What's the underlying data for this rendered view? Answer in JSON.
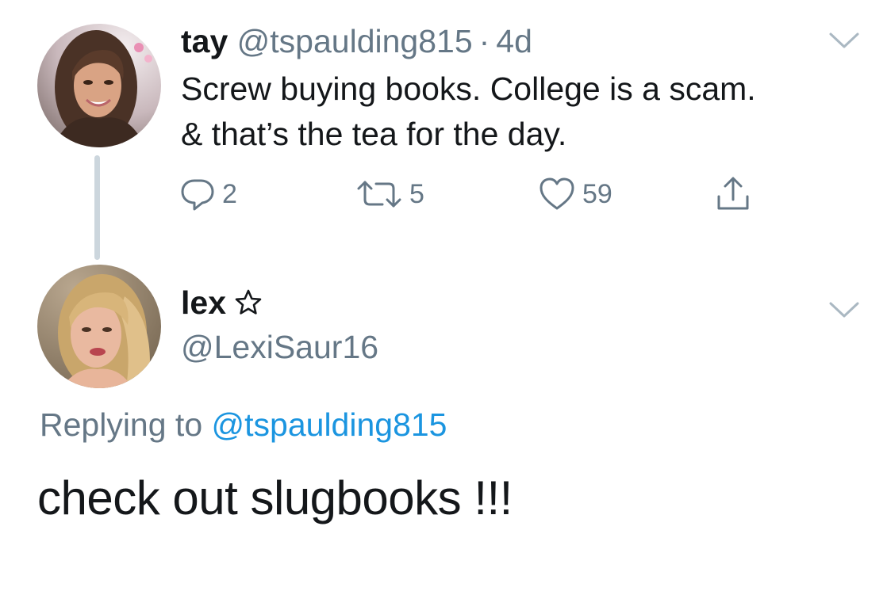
{
  "tweet": {
    "author_name": "tay",
    "author_handle": "@tspaulding815",
    "separator": "·",
    "time": "4d",
    "text_lines": [
      "Screw buying books. College is a scam.",
      "& that’s the tea for the day."
    ],
    "actions": {
      "reply_count": "2",
      "retweet_count": "5",
      "like_count": "59"
    },
    "avatar_icon": "profile-photo-tay"
  },
  "reply": {
    "author_name": "lex",
    "author_handle": "@LexiSaur16",
    "badge_icon": "star-outline-icon",
    "replying_prefix": "Replying to",
    "replying_handle": "@tspaulding815",
    "text": "check out slugbooks !!!",
    "avatar_icon": "profile-photo-lex"
  },
  "colors": {
    "text": "#14171a",
    "muted": "#657786",
    "link": "#1b95e0",
    "thread_line": "#ccd6dd"
  }
}
